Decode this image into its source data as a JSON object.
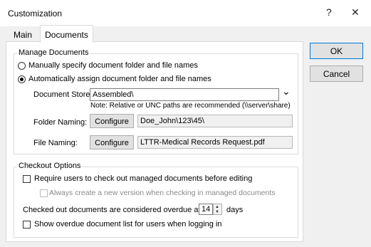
{
  "window": {
    "title": "Customization",
    "help_glyph": "?",
    "close_glyph": "✕"
  },
  "tabs": [
    {
      "label": "Main",
      "active": false
    },
    {
      "label": "Documents",
      "active": true
    }
  ],
  "manage": {
    "legend": "Manage Documents",
    "radio_manual": {
      "label": "Manually specify document folder and file names",
      "selected": false
    },
    "radio_auto": {
      "label": "Automatically assign document folder and file names",
      "selected": true
    },
    "store_label": "Document Store:",
    "store_value": "Assembled\\",
    "store_arrow": "⌄",
    "note": "Note:  Relative or UNC paths are recommended (\\\\server\\share)",
    "folder_label": "Folder Naming:",
    "folder_button": "Configure",
    "folder_value": "Doe_John\\123\\45\\",
    "file_label": "File Naming:",
    "file_button": "Configure",
    "file_value": "LTTR-Medical Records Request.pdf"
  },
  "checkout": {
    "legend": "Checkout Options",
    "require_label": "Require users to check out managed documents before editing",
    "require_checked": false,
    "version_label": "Always create a new version when checking in managed documents",
    "version_checked": false,
    "overdue_label": "Checked out documents are considered overdue after",
    "overdue_value": "14",
    "overdue_unit": "days",
    "show_label": "Show overdue document list for users when logging in",
    "show_checked": false
  },
  "buttons": {
    "ok": "OK",
    "cancel": "Cancel"
  },
  "icons": {
    "radio": "radio-icon",
    "checkbox": "checkbox-icon",
    "spin": "spin-arrows-icon",
    "dropdown": "chevron-down-icon"
  },
  "colors": {
    "dialog_bg": "#f0f0f0",
    "panel_bg": "#ffffff",
    "default_button_border": "#0078d7"
  }
}
